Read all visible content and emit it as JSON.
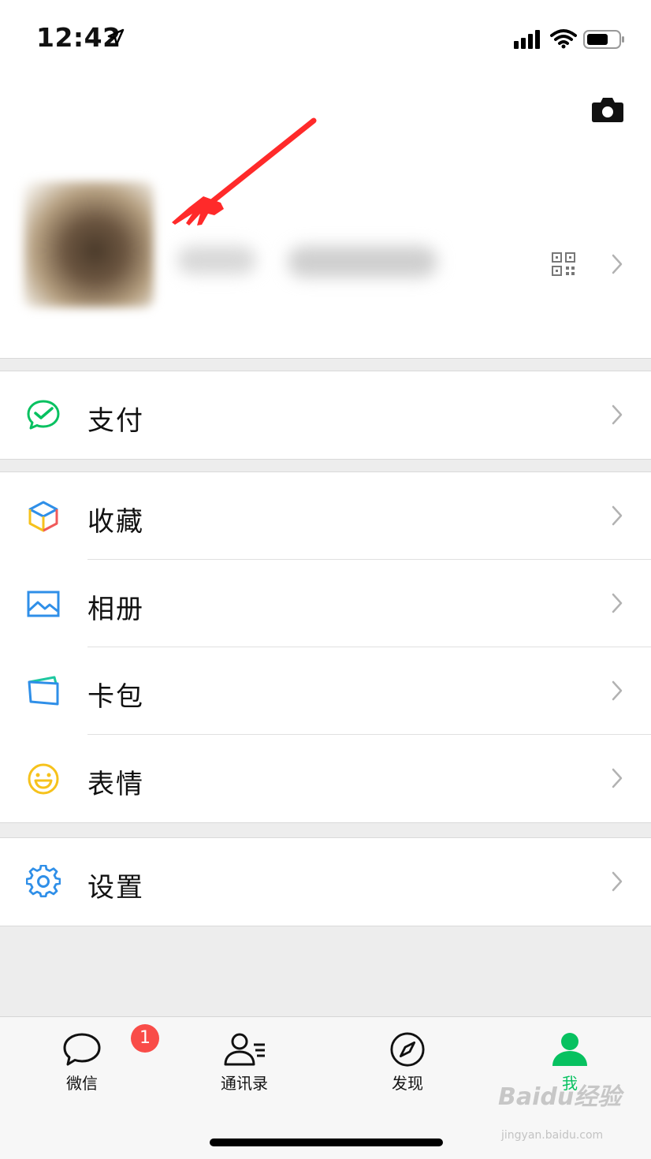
{
  "status_bar": {
    "time": "12:42"
  },
  "profile": {},
  "groups": [
    {
      "items": [
        {
          "label": "支付",
          "icon": "wechat-pay-icon"
        }
      ]
    },
    {
      "items": [
        {
          "label": "收藏",
          "icon": "favorites-cube-icon"
        },
        {
          "label": "相册",
          "icon": "album-picture-icon"
        },
        {
          "label": "卡包",
          "icon": "card-wallet-icon"
        },
        {
          "label": "表情",
          "icon": "sticker-smiley-icon"
        }
      ]
    },
    {
      "items": [
        {
          "label": "设置",
          "icon": "settings-gear-icon"
        }
      ]
    }
  ],
  "tabbar": {
    "tabs": [
      {
        "label": "微信",
        "icon": "chat-bubble-icon",
        "badge": "1"
      },
      {
        "label": "通讯录",
        "icon": "contacts-icon"
      },
      {
        "label": "发现",
        "icon": "compass-icon"
      },
      {
        "label": "我",
        "icon": "person-icon",
        "active": true
      }
    ]
  },
  "watermark": {
    "text": "Baidu经验",
    "sub": "jingyan.baidu.com"
  },
  "colors": {
    "accent_green": "#07c160",
    "badge_red": "#f94c48",
    "annotation_red": "#ff2a2a",
    "background": "#ededed"
  }
}
